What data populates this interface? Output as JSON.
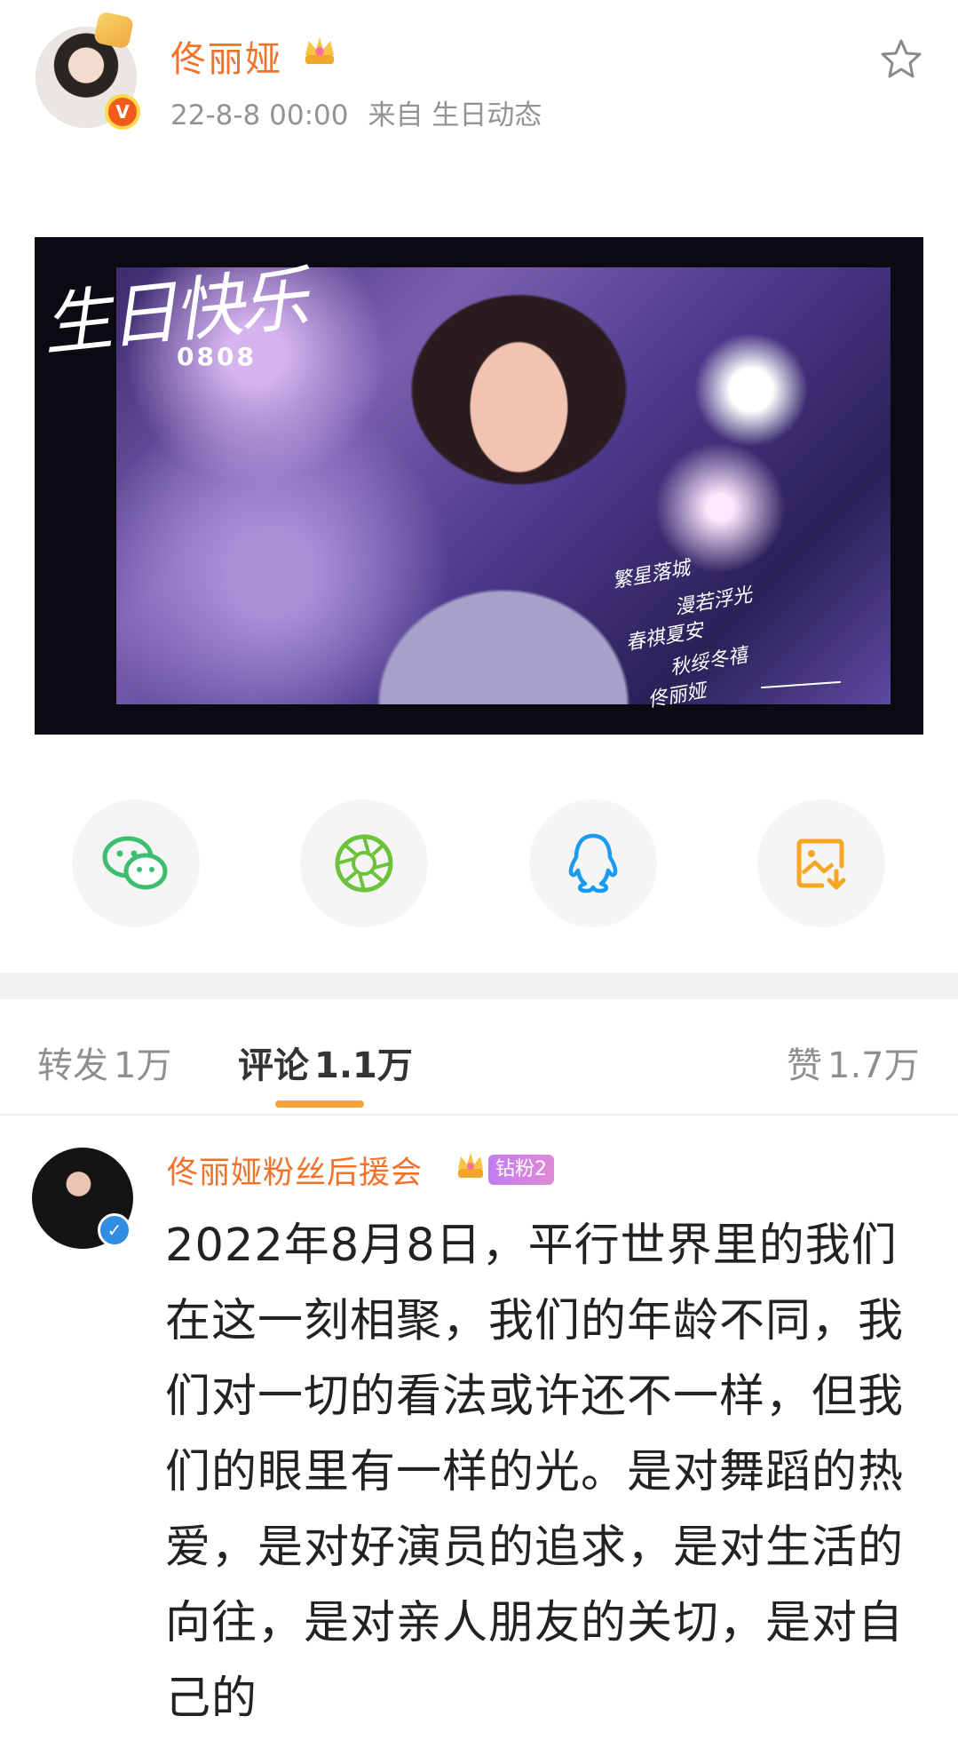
{
  "post": {
    "author": "佟丽娅",
    "time": "22-8-8 00:00",
    "source": "来自 生日动态"
  },
  "image": {
    "title": "生日快乐",
    "date": "0808",
    "poem": [
      "繁星落城",
      "漫若浮光",
      "春祺夏安",
      "秋绥冬禧"
    ],
    "signature": "佟丽娅"
  },
  "share": {
    "icons": [
      "wechat-icon",
      "moments-icon",
      "qq-icon",
      "save-image-icon"
    ],
    "colors": {
      "wechat": "#3bbf6e",
      "moments": "#6cc23a",
      "qq": "#1b9bf0",
      "save": "#f5a623"
    }
  },
  "tabs": {
    "repost_label": "转发",
    "repost_count": "1万",
    "comment_label": "评论",
    "comment_count": "1.1万",
    "like_label": "赞",
    "like_count": "1.7万",
    "accent": "#f7a23b"
  },
  "comment": {
    "author": "佟丽娅粉丝后援会",
    "badge": "钻粉2",
    "text": "2022年8月8日，平行世界里的我们在这一刻相聚，我们的年龄不同，我们对一切的看法或许还不一样，但我们的眼里有一样的光。是对舞蹈的热爱，是对好演员的追求，是对生活的向往，是对亲人朋友的关切，是对自己的"
  }
}
